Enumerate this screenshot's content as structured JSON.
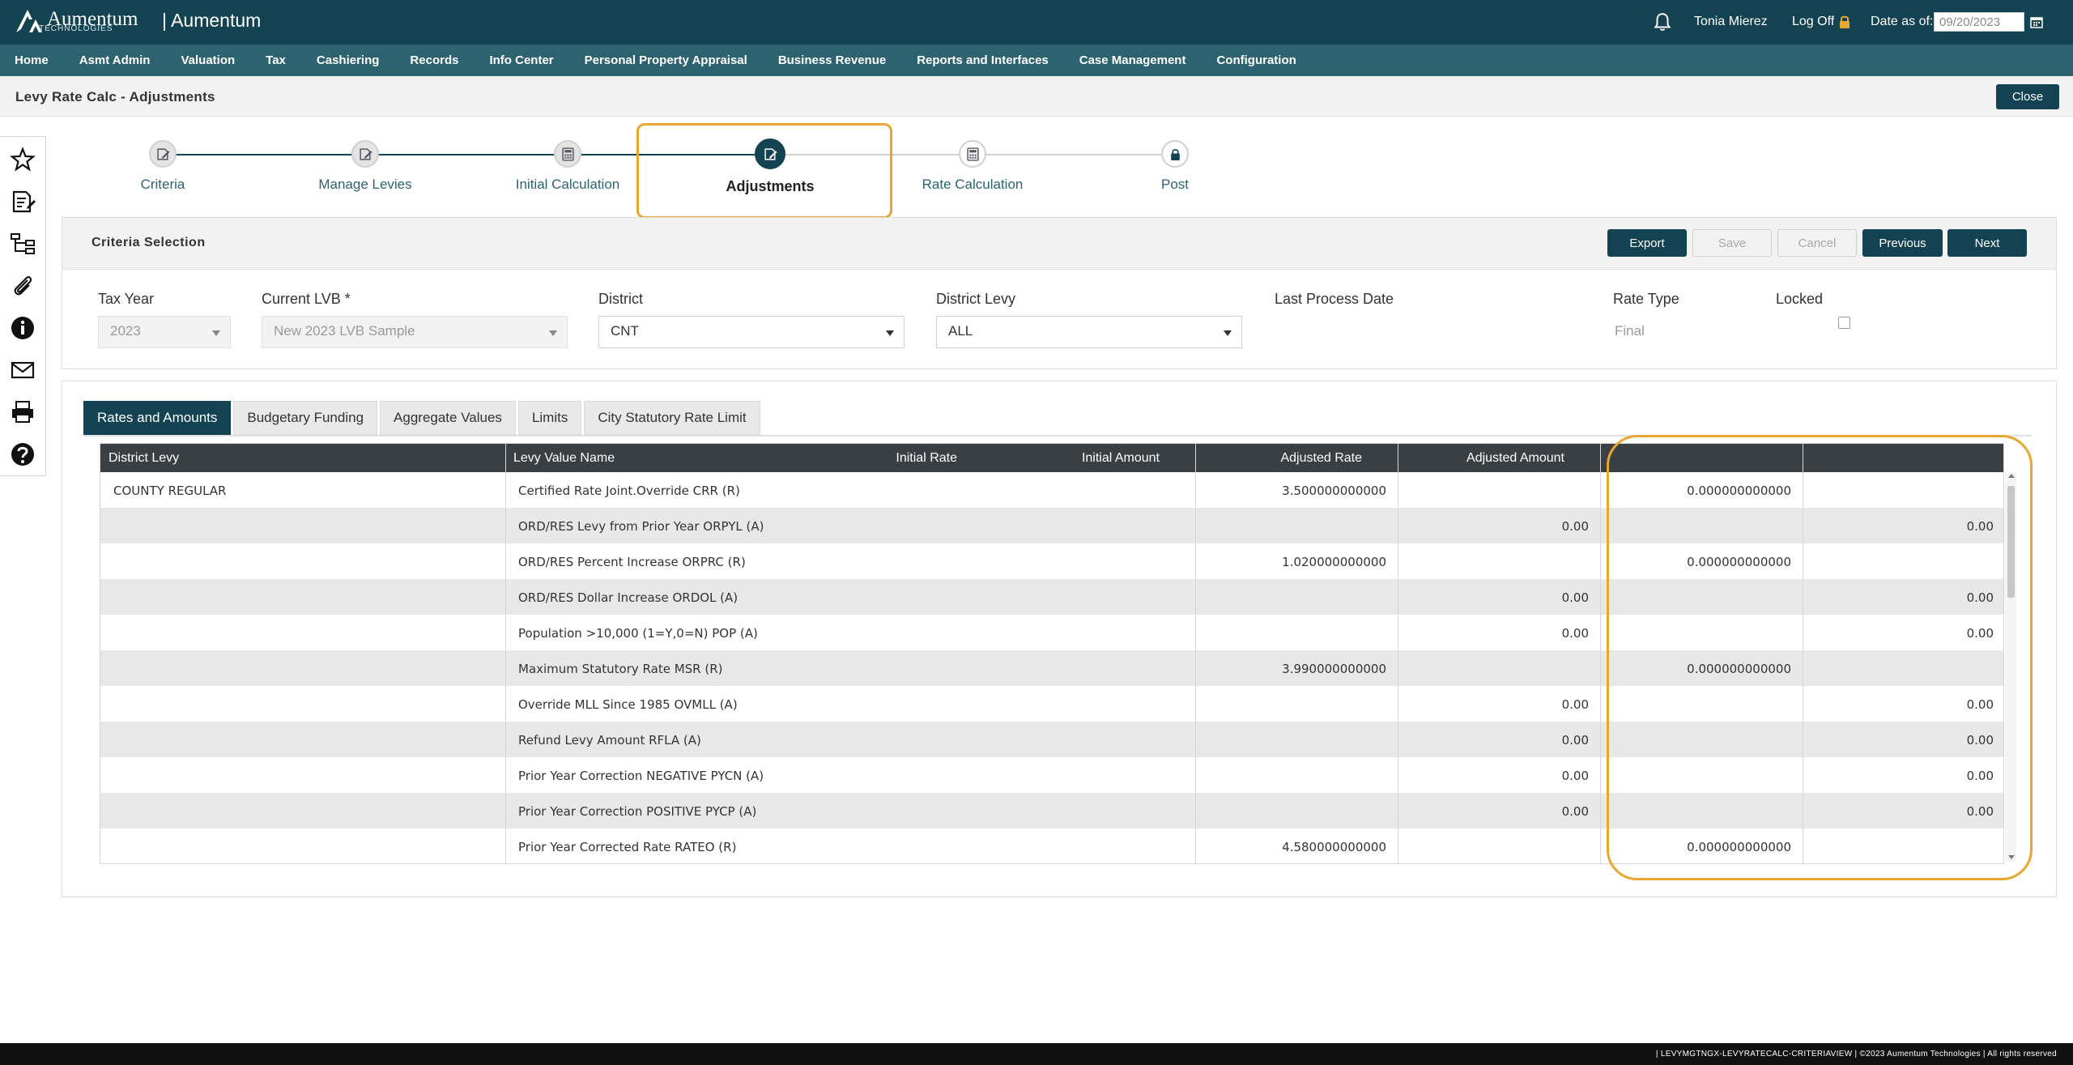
{
  "header": {
    "logo_text": "Aumentum",
    "logo_sub": "TECHNOLOGIES",
    "app_name": "| Aumentum",
    "user_name": "Tonia Mierez",
    "logoff_label": "Log Off",
    "date_label": "Date as of:",
    "date_value": "09/20/2023"
  },
  "nav": [
    "Home",
    "Asmt Admin",
    "Valuation",
    "Tax",
    "Cashiering",
    "Records",
    "Info Center",
    "Personal Property Appraisal",
    "Business Revenue",
    "Reports and Interfaces",
    "Case Management",
    "Configuration"
  ],
  "page": {
    "title": "Levy Rate Calc - Adjustments",
    "close_label": "Close"
  },
  "sidebar_icons": [
    "star-icon",
    "edit-document-icon",
    "hierarchy-icon",
    "paperclip-icon",
    "info-icon",
    "mail-icon",
    "print-icon",
    "help-icon"
  ],
  "steps": [
    {
      "label": "Criteria",
      "icon": "edit-icon",
      "state": "done"
    },
    {
      "label": "Manage Levies",
      "icon": "edit-icon",
      "state": "done"
    },
    {
      "label": "Initial Calculation",
      "icon": "calculator-icon",
      "state": "done"
    },
    {
      "label": "Adjustments",
      "icon": "edit-icon",
      "state": "active"
    },
    {
      "label": "Rate Calculation",
      "icon": "calculator-icon",
      "state": "todo"
    },
    {
      "label": "Post",
      "icon": "lock-icon",
      "state": "todo"
    }
  ],
  "criteria": {
    "title": "Criteria Selection",
    "buttons": {
      "export": "Export",
      "save": "Save",
      "cancel": "Cancel",
      "previous": "Previous",
      "next": "Next"
    },
    "tax_year_label": "Tax Year",
    "tax_year_value": "2023",
    "lvb_label": "Current LVB *",
    "lvb_value": "New 2023 LVB Sample",
    "district_label": "District",
    "district_value": "CNT",
    "district_levy_label": "District Levy",
    "district_levy_value": "ALL",
    "last_process_label": "Last Process Date",
    "rate_type_label": "Rate Type",
    "rate_type_value": "Final",
    "locked_label": "Locked",
    "locked_checked": false
  },
  "tabs": [
    "Rates and Amounts",
    "Budgetary Funding",
    "Aggregate Values",
    "Limits",
    "City Statutory Rate Limit"
  ],
  "table": {
    "columns": [
      "District Levy",
      "Levy Value Name",
      "Initial Rate",
      "Initial Amount",
      "Adjusted Rate",
      "Adjusted Amount"
    ],
    "rows": [
      [
        "COUNTY REGULAR",
        "Certified Rate Joint.Override CRR (R)",
        "3.500000000000",
        "",
        "0.000000000000",
        ""
      ],
      [
        "",
        "ORD/RES Levy from Prior Year ORPYL (A)",
        "",
        "0.00",
        "",
        "0.00"
      ],
      [
        "",
        "ORD/RES Percent Increase ORPRC (R)",
        "1.020000000000",
        "",
        "0.000000000000",
        ""
      ],
      [
        "",
        "ORD/RES Dollar Increase ORDOL (A)",
        "",
        "0.00",
        "",
        "0.00"
      ],
      [
        "",
        "Population >10,000 (1=Y,0=N) POP (A)",
        "",
        "0.00",
        "",
        "0.00"
      ],
      [
        "",
        "Maximum Statutory Rate MSR (R)",
        "3.990000000000",
        "",
        "0.000000000000",
        ""
      ],
      [
        "",
        "Override MLL Since 1985 OVMLL (A)",
        "",
        "0.00",
        "",
        "0.00"
      ],
      [
        "",
        "Refund Levy Amount RFLA (A)",
        "",
        "0.00",
        "",
        "0.00"
      ],
      [
        "",
        "Prior Year Correction NEGATIVE PYCN (A)",
        "",
        "0.00",
        "",
        "0.00"
      ],
      [
        "",
        "Prior Year Correction POSITIVE PYCP (A)",
        "",
        "0.00",
        "",
        "0.00"
      ],
      [
        "",
        "Prior Year Corrected Rate RATEO (R)",
        "4.580000000000",
        "",
        "0.000000000000",
        ""
      ]
    ]
  },
  "footer": {
    "text": "|   LEVYMGTNGX-LEVYRATECALC-CRITERIAVIEW    |   ©2023 Aumentum Technologies | All rights reserved"
  },
  "colors": {
    "primary": "#134352",
    "nav": "#2d6370",
    "highlight": "#e8a632",
    "table_header": "#3a3f44"
  }
}
